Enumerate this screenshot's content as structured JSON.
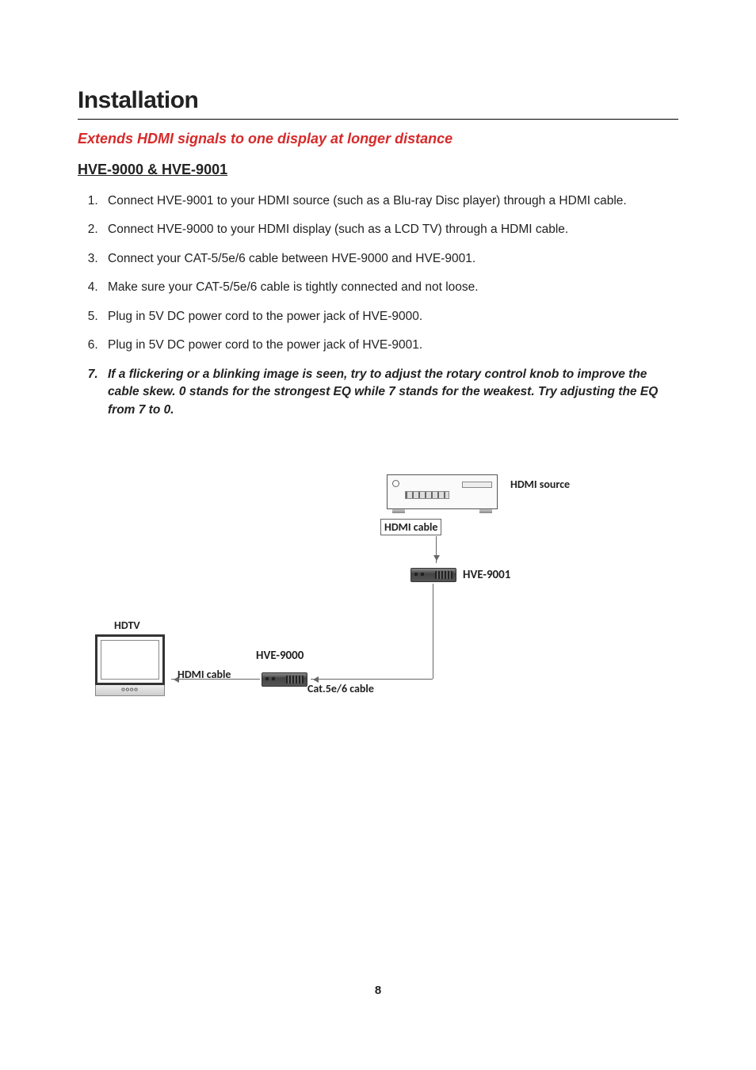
{
  "title": "Installation",
  "subtitle": "Extends HDMI signals to one display at longer distance",
  "model_heading": "HVE-9000 & HVE-9001",
  "steps": [
    {
      "text": "Connect HVE-9001 to your HDMI source (such as a Blu-ray Disc player) through a HDMI cable.",
      "emphasis": false
    },
    {
      "text": "Connect HVE-9000 to your HDMI display (such as a LCD TV) through a HDMI cable.",
      "emphasis": false
    },
    {
      "text": "Connect your CAT-5/5e/6 cable between HVE-9000 and HVE-9001.",
      "emphasis": false
    },
    {
      "text": "Make sure your CAT-5/5e/6 cable is tightly connected and not loose.",
      "emphasis": false
    },
    {
      "text": "Plug in 5V DC power cord to the power jack of HVE-9000.",
      "emphasis": false
    },
    {
      "text": "Plug in 5V DC power cord to the power jack of HVE-9001.",
      "emphasis": false
    },
    {
      "text": "If a flickering or a blinking image is seen, try to adjust the rotary control knob to improve the cable skew. 0 stands for the strongest EQ while 7 stands for the weakest. Try adjusting the EQ from 7 to 0.",
      "emphasis": true
    }
  ],
  "figure": {
    "hdmi_source": "HDMI source",
    "hdmi_cable_1": "HDMI cable",
    "hve_9001": "HVE-9001",
    "hve_9000": "HVE-9000",
    "cat_cable": "Cat.5e/6 cable",
    "hdmi_cable_2": "HDMI cable",
    "hdtv": "HDTV"
  },
  "page_number": "8"
}
